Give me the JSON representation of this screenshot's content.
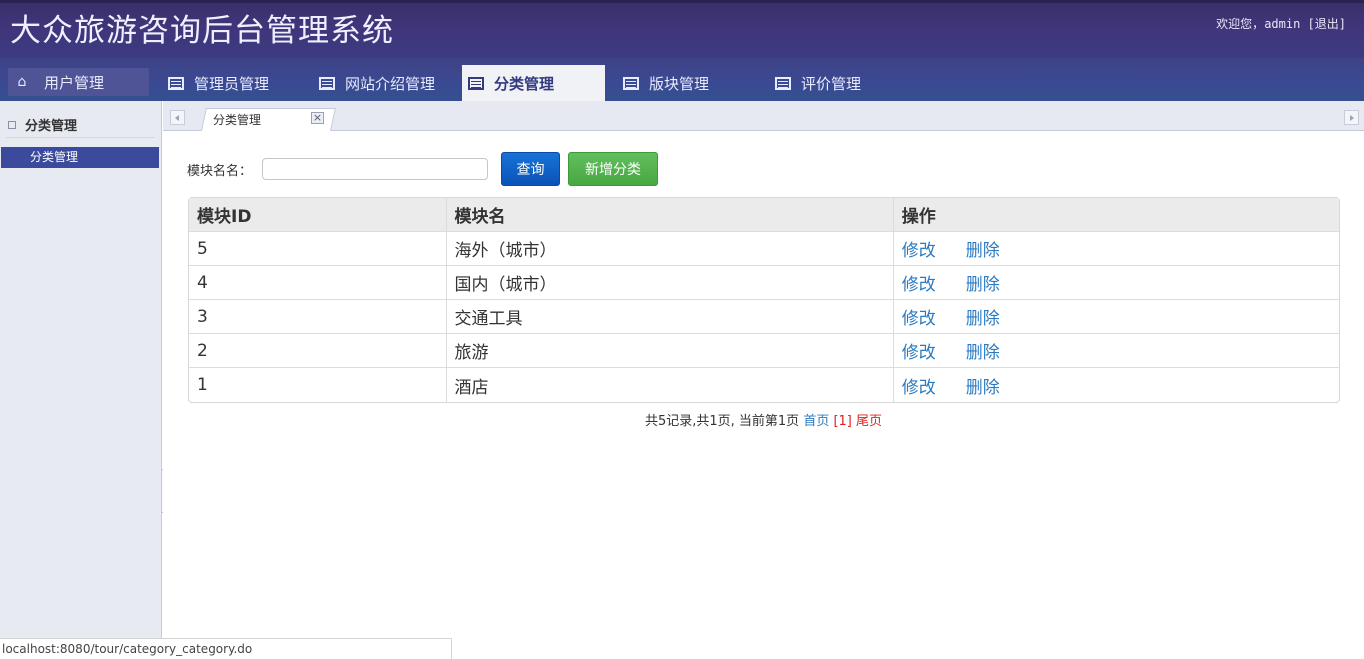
{
  "header": {
    "title": "大众旅游咨询后台管理系统",
    "welcome_prefix": "欢迎您，",
    "username": "admin",
    "logout_label": "[退出]"
  },
  "nav": {
    "items": [
      {
        "label": "用户管理",
        "icon": "home-icon"
      },
      {
        "label": "管理员管理",
        "icon": "list-icon"
      },
      {
        "label": "网站介绍管理",
        "icon": "list-icon"
      },
      {
        "label": "分类管理",
        "icon": "list-icon",
        "active": true
      },
      {
        "label": "版块管理",
        "icon": "list-icon"
      },
      {
        "label": "评价管理",
        "icon": "list-icon"
      }
    ]
  },
  "sidebar": {
    "heading": "分类管理",
    "items": [
      {
        "label": "分类管理",
        "selected": true
      }
    ]
  },
  "tabs": [
    {
      "label": "分类管理",
      "close_symbol": "×"
    }
  ],
  "search": {
    "label": "模块名名：",
    "value": "",
    "placeholder": "",
    "query_label": "查询",
    "add_label": "新增分类"
  },
  "table": {
    "headers": [
      "模块ID",
      "模块名",
      "操作"
    ],
    "rows": [
      {
        "id": "5",
        "name": "海外（城市）"
      },
      {
        "id": "4",
        "name": "国内（城市）"
      },
      {
        "id": "3",
        "name": "交通工具"
      },
      {
        "id": "2",
        "name": "旅游"
      },
      {
        "id": "1",
        "name": "酒店"
      }
    ],
    "edit_label": "修改",
    "delete_label": "删除"
  },
  "pager": {
    "summary": "共5记录,共1页, 当前第1页 ",
    "first_label": "首页",
    "current_label": " [1] ",
    "last_label": "尾页"
  },
  "statusbar": {
    "url": "localhost:8080/tour/category_category.do"
  },
  "colors": {
    "header_bg": "#3d3575",
    "nav_bg": "#3a4a92",
    "sidebar_selected": "#3c4a9e",
    "query_button": "#0a53b8",
    "add_button": "#47a842",
    "link": "#2b7ac2",
    "pager_red": "#dd2222"
  }
}
